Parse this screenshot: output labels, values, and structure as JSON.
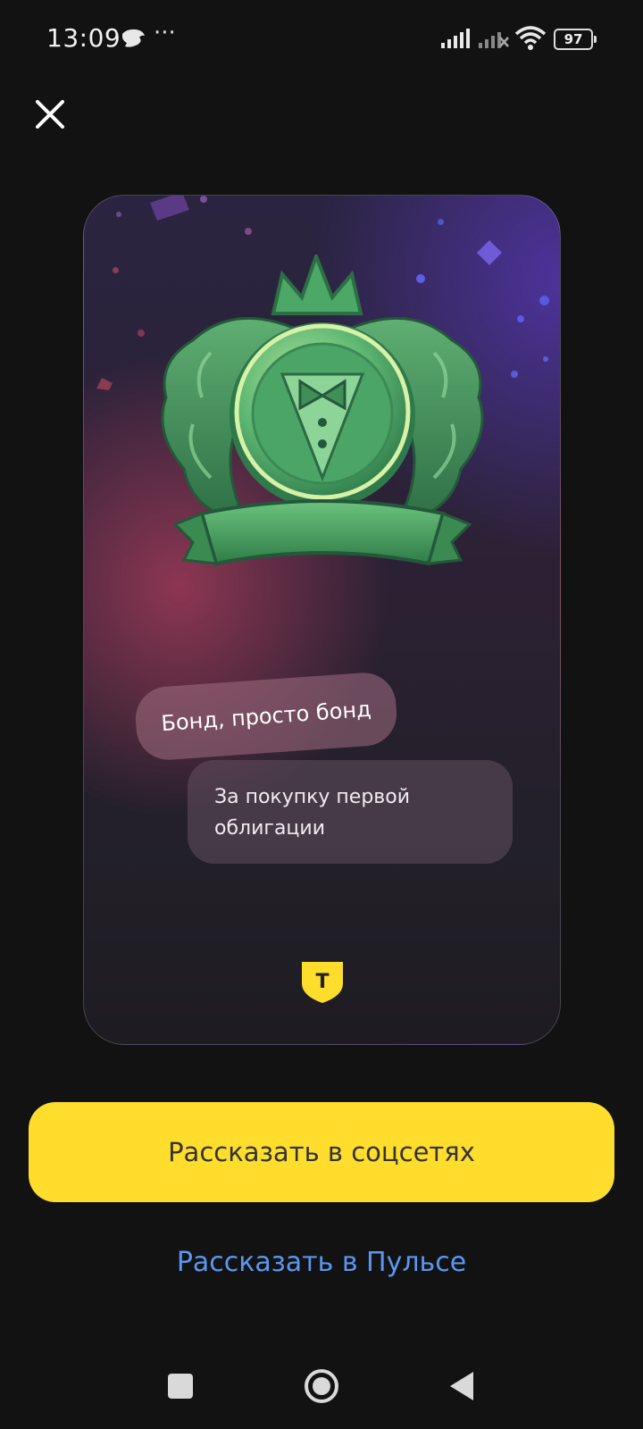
{
  "status_bar": {
    "time": "13:09",
    "battery": "97",
    "more": "···"
  },
  "card": {
    "badge_title": "Бонд, просто бонд",
    "badge_description": "За покупку первой облигации",
    "logo_letter": "Т"
  },
  "actions": {
    "share_social": "Рассказать в соцсетях",
    "share_pulse": "Рассказать в Пульсе"
  },
  "colors": {
    "background": "#121212",
    "accent_yellow": "#ffdd2d",
    "link_blue": "#5b97f0",
    "badge_green": "#3f9a5d"
  }
}
